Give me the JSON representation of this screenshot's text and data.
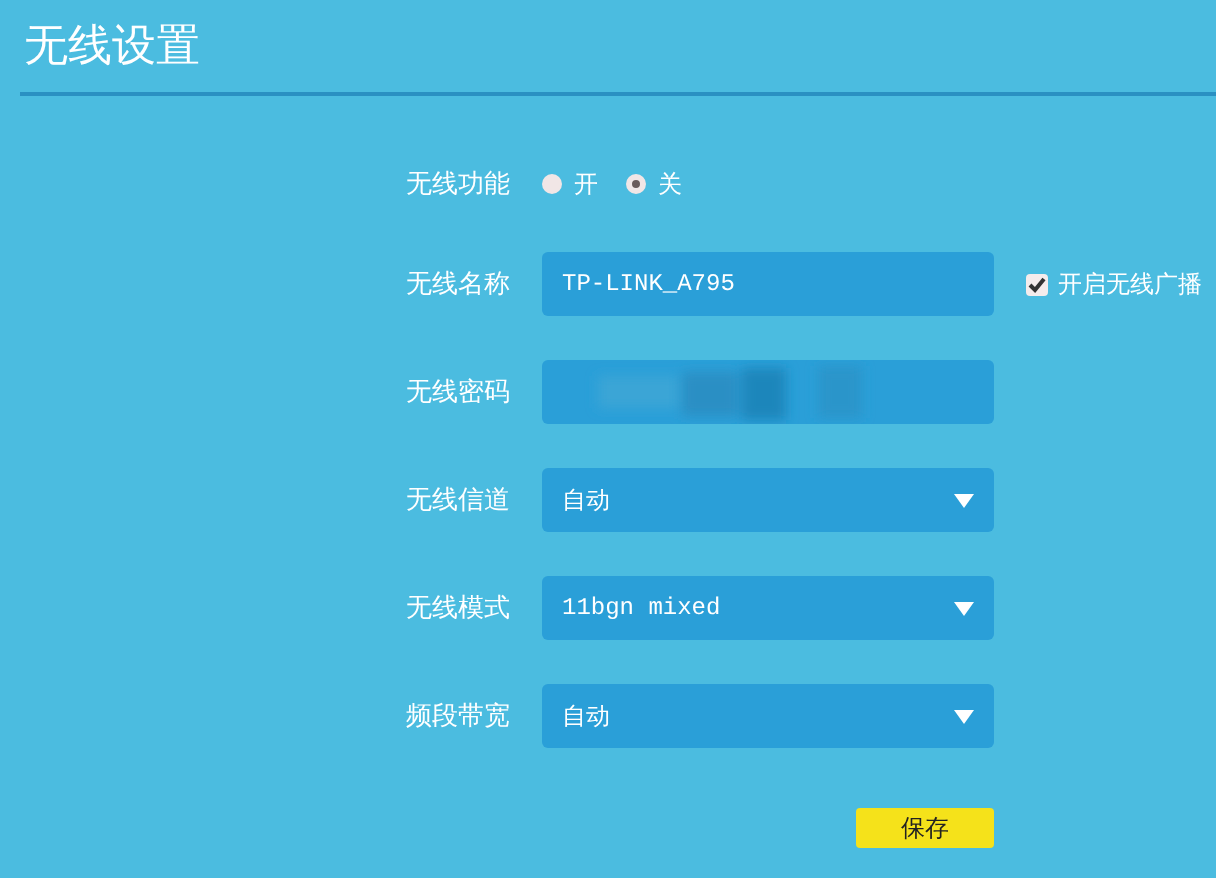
{
  "page": {
    "title": "无线设置"
  },
  "rows": [
    {
      "kind": "radio",
      "label": "无线功能",
      "options": [
        {
          "label": "开",
          "selected": false
        },
        {
          "label": "关",
          "selected": true
        }
      ]
    },
    {
      "kind": "text",
      "label": "无线名称",
      "value": "TP-LINK_A795",
      "extra": {
        "label": "开启无线广播",
        "checked": true
      }
    },
    {
      "kind": "password",
      "label": "无线密码"
    },
    {
      "kind": "select",
      "label": "无线信道",
      "value": "自动"
    },
    {
      "kind": "select",
      "label": "无线模式",
      "value": "11bgn mixed"
    },
    {
      "kind": "select",
      "label": "频段带宽",
      "value": "自动"
    }
  ],
  "save_button": "保存"
}
